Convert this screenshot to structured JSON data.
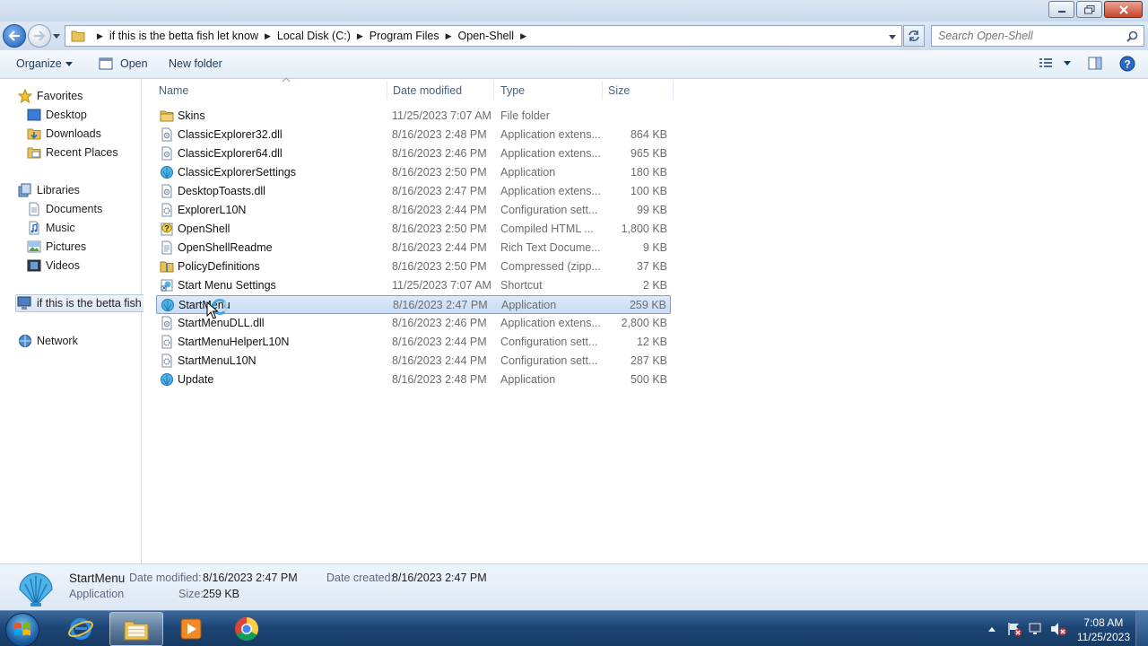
{
  "window": {
    "controls": [
      "minimize",
      "maximize",
      "close"
    ]
  },
  "address": {
    "breadcrumbs": [
      "if this is the betta fish let know",
      "Local Disk (C:)",
      "Program Files",
      "Open-Shell"
    ],
    "search_placeholder": "Search Open-Shell"
  },
  "toolbar": {
    "organize_label": "Organize",
    "open_label": "Open",
    "new_folder_label": "New folder"
  },
  "navpane": {
    "favorites": {
      "label": "Favorites",
      "items": [
        "Desktop",
        "Downloads",
        "Recent Places"
      ]
    },
    "libraries": {
      "label": "Libraries",
      "items": [
        "Documents",
        "Music",
        "Pictures",
        "Videos"
      ]
    },
    "computer": {
      "label": "if this is the betta fish"
    },
    "network": {
      "label": "Network"
    }
  },
  "columns": {
    "name": "Name",
    "date": "Date modified",
    "type": "Type",
    "size": "Size"
  },
  "files": [
    {
      "name": "Skins",
      "date": "11/25/2023 7:07 AM",
      "type": "File folder",
      "size": "",
      "icon": "folder-icon"
    },
    {
      "name": "ClassicExplorer32.dll",
      "date": "8/16/2023 2:48 PM",
      "type": "Application extens...",
      "size": "864 KB",
      "icon": "dll-icon"
    },
    {
      "name": "ClassicExplorer64.dll",
      "date": "8/16/2023 2:46 PM",
      "type": "Application extens...",
      "size": "965 KB",
      "icon": "dll-icon"
    },
    {
      "name": "ClassicExplorerSettings",
      "date": "8/16/2023 2:50 PM",
      "type": "Application",
      "size": "180 KB",
      "icon": "shell-app-icon"
    },
    {
      "name": "DesktopToasts.dll",
      "date": "8/16/2023 2:47 PM",
      "type": "Application extens...",
      "size": "100 KB",
      "icon": "dll-icon"
    },
    {
      "name": "ExplorerL10N",
      "date": "8/16/2023 2:44 PM",
      "type": "Configuration sett...",
      "size": "99 KB",
      "icon": "config-icon"
    },
    {
      "name": "OpenShell",
      "date": "8/16/2023 2:50 PM",
      "type": "Compiled HTML ...",
      "size": "1,800 KB",
      "icon": "help-file-icon"
    },
    {
      "name": "OpenShellReadme",
      "date": "8/16/2023 2:44 PM",
      "type": "Rich Text Docume...",
      "size": "9 KB",
      "icon": "document-icon"
    },
    {
      "name": "PolicyDefinitions",
      "date": "8/16/2023 2:50 PM",
      "type": "Compressed (zipp...",
      "size": "37 KB",
      "icon": "zip-folder-icon"
    },
    {
      "name": "Start Menu Settings",
      "date": "11/25/2023 7:07 AM",
      "type": "Shortcut",
      "size": "2 KB",
      "icon": "shortcut-icon"
    },
    {
      "name": "StartMenu",
      "date": "8/16/2023 2:47 PM",
      "type": "Application",
      "size": "259 KB",
      "icon": "shell-app-icon",
      "selected": true
    },
    {
      "name": "StartMenuDLL.dll",
      "date": "8/16/2023 2:46 PM",
      "type": "Application extens...",
      "size": "2,800 KB",
      "icon": "dll-icon"
    },
    {
      "name": "StartMenuHelperL10N",
      "date": "8/16/2023 2:44 PM",
      "type": "Configuration sett...",
      "size": "12 KB",
      "icon": "config-icon"
    },
    {
      "name": "StartMenuL10N",
      "date": "8/16/2023 2:44 PM",
      "type": "Configuration sett...",
      "size": "287 KB",
      "icon": "config-icon"
    },
    {
      "name": "Update",
      "date": "8/16/2023 2:48 PM",
      "type": "Application",
      "size": "500 KB",
      "icon": "shell-app-icon"
    }
  ],
  "details": {
    "name": "StartMenu",
    "type": "Application",
    "modified_label": "Date modified:",
    "modified_value": "8/16/2023 2:47 PM",
    "created_label": "Date created:",
    "created_value": "8/16/2023 2:47 PM",
    "size_label": "Size:",
    "size_value": "259 KB"
  },
  "taskbar": {
    "apps": [
      "internet-explorer-icon",
      "windows-explorer-icon",
      "media-player-icon",
      "chrome-icon"
    ],
    "clock_time": "7:08 AM",
    "clock_date": "11/25/2023"
  },
  "colors": {
    "selection": "#c7dcf5",
    "link_text": "#1e395b",
    "taskbar": "#1d4676"
  }
}
